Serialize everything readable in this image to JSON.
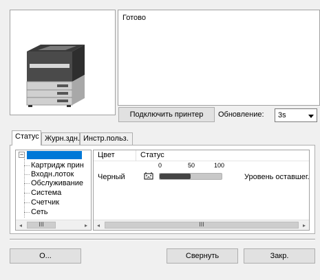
{
  "status": {
    "text": "Готово"
  },
  "printer": {
    "image_icon": "laser-printer-icon"
  },
  "controls": {
    "connect_label": "Подключить принтер",
    "refresh_label": "Обновление:",
    "refresh_value": "3s",
    "refresh_options": [
      "3s"
    ]
  },
  "tabs": [
    {
      "label": "Статус",
      "active": true
    },
    {
      "label": "Журн.здн.",
      "active": false
    },
    {
      "label": "Инстр.польз.",
      "active": false
    }
  ],
  "tree": {
    "collapse_symbol": "−",
    "items": [
      "Картридж прин",
      "Входн.лоток",
      "Обслуживание",
      "Система",
      "Счетчик",
      "Сеть"
    ]
  },
  "list": {
    "columns": [
      "Цвет",
      "Статус"
    ],
    "scale_labels": [
      "0",
      "50",
      "100"
    ],
    "rows": [
      {
        "color": "Черный",
        "level": 0.5,
        "status": "Уровень оставшег..."
      }
    ]
  },
  "scroll": {
    "left": "◂",
    "right": "▸",
    "thumb": "III"
  },
  "buttons": {
    "options_label": "О...",
    "minimize_label": "Свернуть",
    "close_label": "Закр."
  },
  "colors": {
    "selection": "#0078d7",
    "toner_fill": "#444444",
    "toner_track": "#c8c8c8"
  }
}
